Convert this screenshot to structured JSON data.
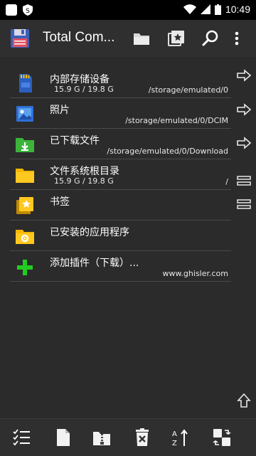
{
  "status_bar": {
    "time": "10:49"
  },
  "app_bar": {
    "title": "Total Com..."
  },
  "items": [
    {
      "name": "内部存储设备",
      "size": "15.9 G / 19.8 G",
      "path": "/storage/emulated/0"
    },
    {
      "name": "照片",
      "size": "",
      "path": "/storage/emulated/0/DCIM"
    },
    {
      "name": "已下载文件",
      "size": "",
      "path": "/storage/emulated/0/Download"
    },
    {
      "name": "文件系统根目录",
      "size": "15.9 G / 19.8 G",
      "path": "/"
    },
    {
      "name": "书签",
      "size": "",
      "path": ""
    },
    {
      "name": "已安装的应用程序",
      "size": "",
      "path": ""
    },
    {
      "name": "添加插件（下载）...",
      "size": "",
      "path": "www.ghisler.com"
    }
  ],
  "colors": {
    "folder": "#f5b800",
    "plugin": "#22cc22",
    "background": "#2b2b2b"
  }
}
